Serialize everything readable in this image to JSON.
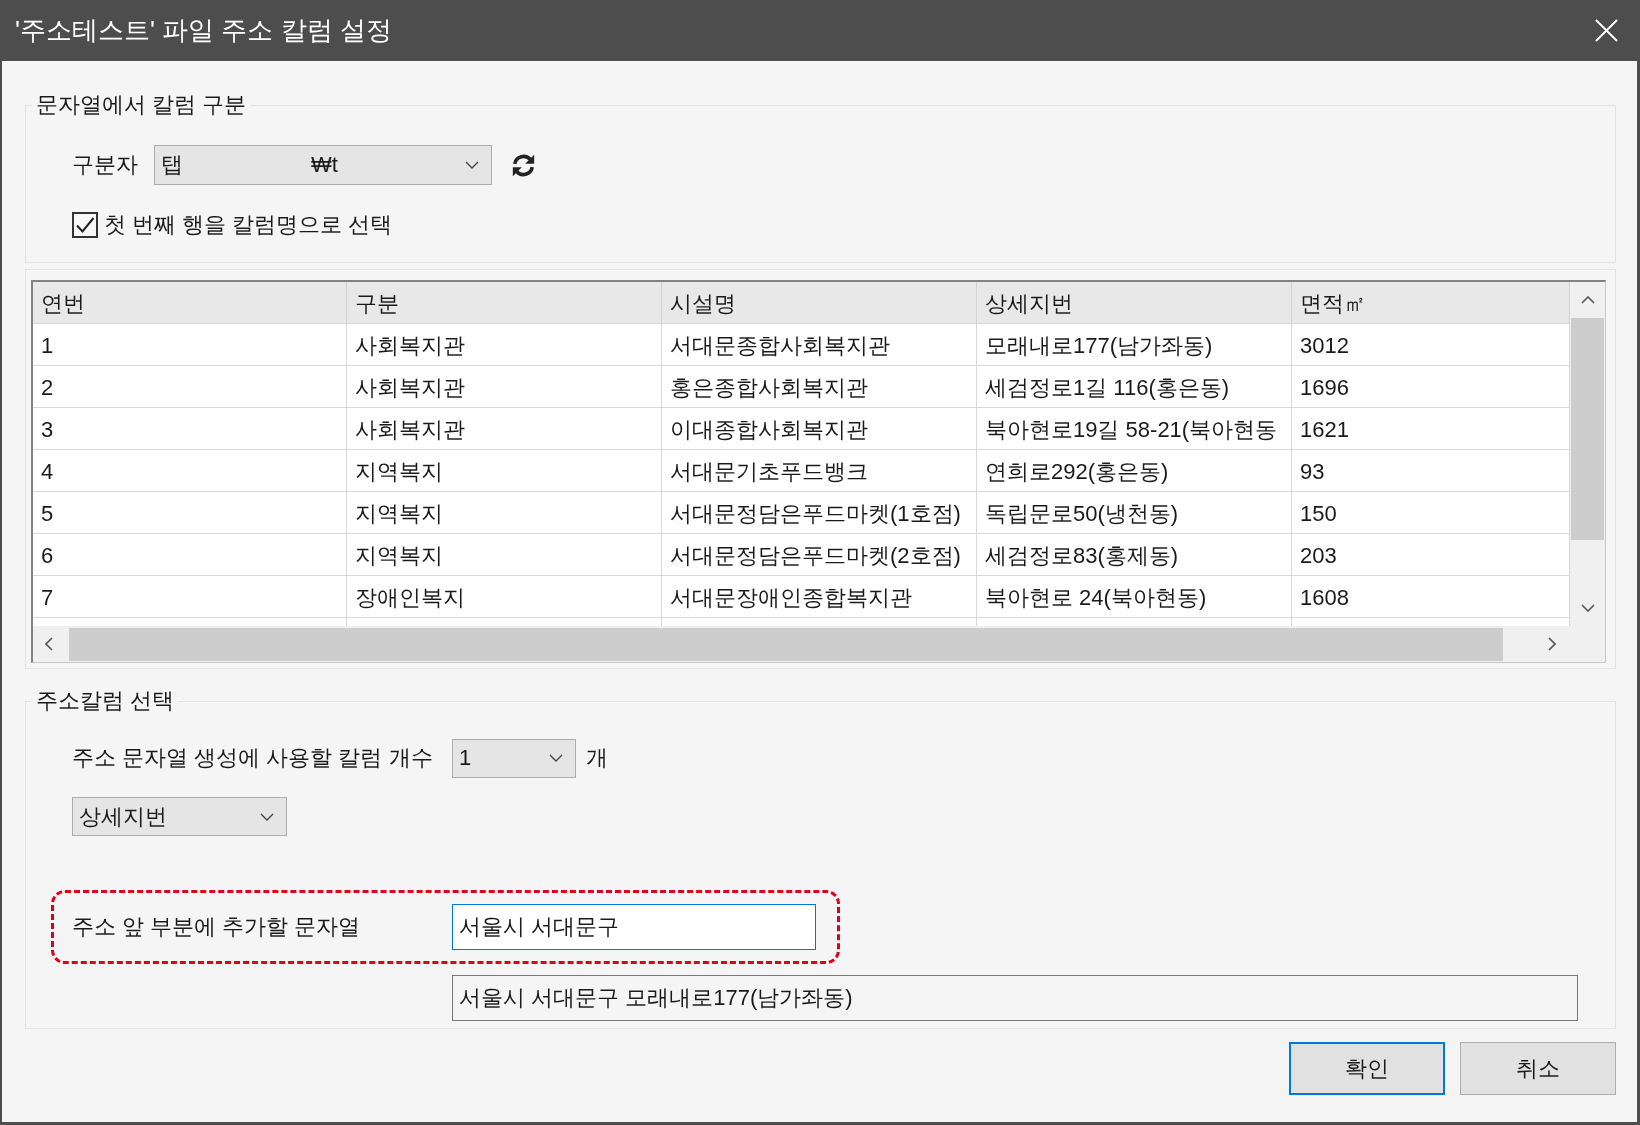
{
  "window": {
    "title": "'주소테스트' 파일 주소 칼럼 설정"
  },
  "split_group": {
    "legend": "문자열에서 칼럼 구분",
    "delimiter": {
      "label": "구분자",
      "value": "탭",
      "code": "₩t"
    },
    "first_row_header": {
      "label": "첫 번째 행을 칼럼명으로 선택",
      "checked": true
    }
  },
  "table": {
    "columns": [
      "연번",
      "구분",
      "시설명",
      "상세지번",
      "면적㎡"
    ],
    "rows": [
      [
        "1",
        "사회복지관",
        "서대문종합사회복지관",
        "모래내로177(남가좌동)",
        "3012"
      ],
      [
        "2",
        "사회복지관",
        "홍은종합사회복지관",
        "세검정로1길 116(홍은동)",
        "1696"
      ],
      [
        "3",
        "사회복지관",
        "이대종합사회복지관",
        "북아현로19길 58-21(북아현동",
        "1621"
      ],
      [
        "4",
        "지역복지",
        "서대문기초푸드뱅크",
        "연희로292(홍은동)",
        "93"
      ],
      [
        "5",
        "지역복지",
        "서대문정담은푸드마켓(1호점)",
        "독립문로50(냉천동)",
        "150"
      ],
      [
        "6",
        "지역복지",
        "서대문정담은푸드마켓(2호점)",
        "세검정로83(홍제동)",
        "203"
      ],
      [
        "7",
        "장애인복지",
        "서대문장애인종합복지관",
        "북아현로 24(북아현동)",
        "1608"
      ]
    ]
  },
  "address_group": {
    "legend": "주소칼럼 선택",
    "column_count": {
      "label": "주소 문자열 생성에 사용할 칼럼 개수",
      "value": "1",
      "unit": "개"
    },
    "column_selects": [
      {
        "value": "상세지번"
      }
    ],
    "prefix": {
      "label": "주소 앞 부분에 추가할 문자열",
      "value": "서울시 서대문구",
      "highlighted": true,
      "focused": true
    },
    "preview": {
      "value": "서울시 서대문구 모래내로177(남가좌동)"
    }
  },
  "buttons": [
    {
      "label": "확인",
      "default": true
    },
    {
      "label": "취소",
      "default": false
    }
  ]
}
